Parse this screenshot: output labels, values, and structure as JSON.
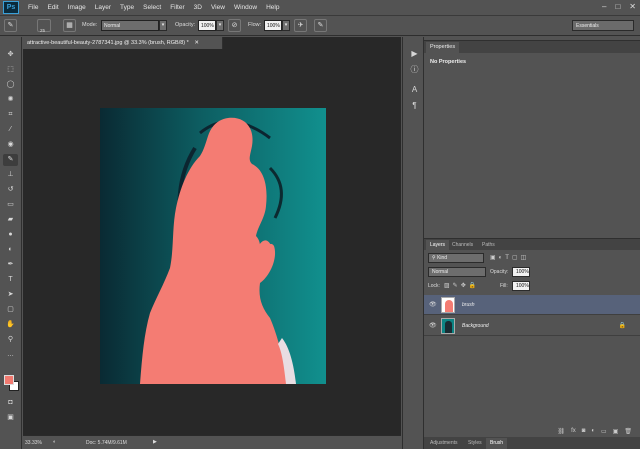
{
  "app": {
    "logo": "Ps"
  },
  "menu": [
    "File",
    "Edit",
    "Image",
    "Layer",
    "Type",
    "Select",
    "Filter",
    "3D",
    "View",
    "Window",
    "Help"
  ],
  "window_controls": {
    "minimize": "–",
    "maximize": "□",
    "close": "✕"
  },
  "options_bar": {
    "brush_size": "25",
    "mode_label": "Mode:",
    "mode_value": "Normal",
    "opacity_label": "Opacity:",
    "opacity_value": "100%",
    "flow_label": "Flow:",
    "flow_value": "100%",
    "workspace": "Essentials"
  },
  "document": {
    "tab_title": "attractive-beautiful-beauty-2787341.jpg @ 33.3% (brush, RGB/8) *",
    "zoom": "33.33%",
    "doc_size": "Doc: 5.74M/9.61M"
  },
  "colors": {
    "foreground": "#f27a70",
    "background": "#ffffff",
    "canvas_teal": "#0d8584",
    "silhouette": "#f47c73"
  },
  "properties": {
    "tab": "Properties",
    "body": "No Properties"
  },
  "layers_panel": {
    "tabs": [
      "Layers",
      "Channels",
      "Paths"
    ],
    "filter_kind": "Kind",
    "blend_mode": "Normal",
    "opacity_label": "Opacity:",
    "opacity_value": "100%",
    "lock_label": "Lock:",
    "fill_label": "Fill:",
    "fill_value": "100%",
    "layers": [
      {
        "name": "brush",
        "selected": true
      },
      {
        "name": "Background",
        "selected": false,
        "locked": true
      }
    ]
  },
  "bottom_tabs": [
    "Adjustments",
    "Styles",
    "Brush"
  ]
}
